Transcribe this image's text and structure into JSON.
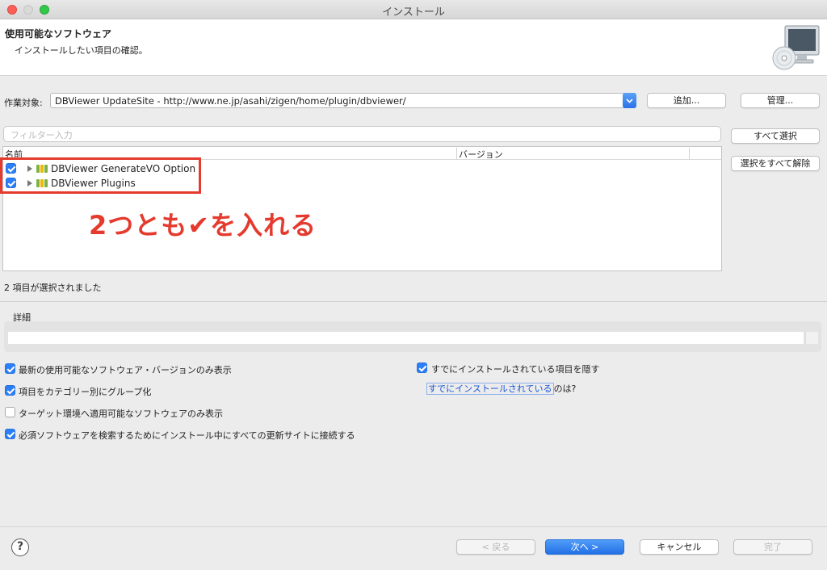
{
  "window": {
    "title": "インストール"
  },
  "header": {
    "title": "使用可能なソフトウェア",
    "subtitle": "インストールしたい項目の確認。"
  },
  "work_target": {
    "label": "作業対象:",
    "value": "DBViewer UpdateSite - http://www.ne.jp/asahi/zigen/home/plugin/dbviewer/",
    "add_label": "追加...",
    "manage_label": "管理..."
  },
  "filter": {
    "placeholder": "フィルター入力"
  },
  "side_buttons": {
    "select_all": "すべて選択",
    "deselect_all": "選択をすべて解除"
  },
  "tree": {
    "col_name": "名前",
    "col_version": "バージョン",
    "items": [
      {
        "label": "DBViewer GenerateVO Option",
        "checked": true
      },
      {
        "label": "DBViewer Plugins",
        "checked": true
      }
    ]
  },
  "annotation": "2つとも✔を入れる",
  "selection_status": "2 項目が選択されました",
  "details": {
    "label": "詳細"
  },
  "options": {
    "latest_only": {
      "label": "最新の使用可能なソフトウェア・バージョンのみ表示",
      "checked": true
    },
    "group_by_category": {
      "label": "項目をカテゴリー別にグループ化",
      "checked": true
    },
    "target_env_only": {
      "label": "ターゲット環境へ適用可能なソフトウェアのみ表示",
      "checked": false
    },
    "contact_all_sites": {
      "label": "必須ソフトウェアを検索するためにインストール中にすべての更新サイトに接続する",
      "checked": true
    },
    "hide_installed": {
      "label": "すでにインストールされている項目を隠す",
      "checked": true
    }
  },
  "installed_link": {
    "link_text": "すでにインストールされている",
    "suffix": "のは?"
  },
  "footer": {
    "back": "< 戻る",
    "next": "次へ >",
    "cancel": "キャンセル",
    "finish": "完了",
    "help_icon": "?"
  },
  "colors": {
    "accent": "#2d7ff9",
    "annotation_red": "#e53a2e"
  }
}
